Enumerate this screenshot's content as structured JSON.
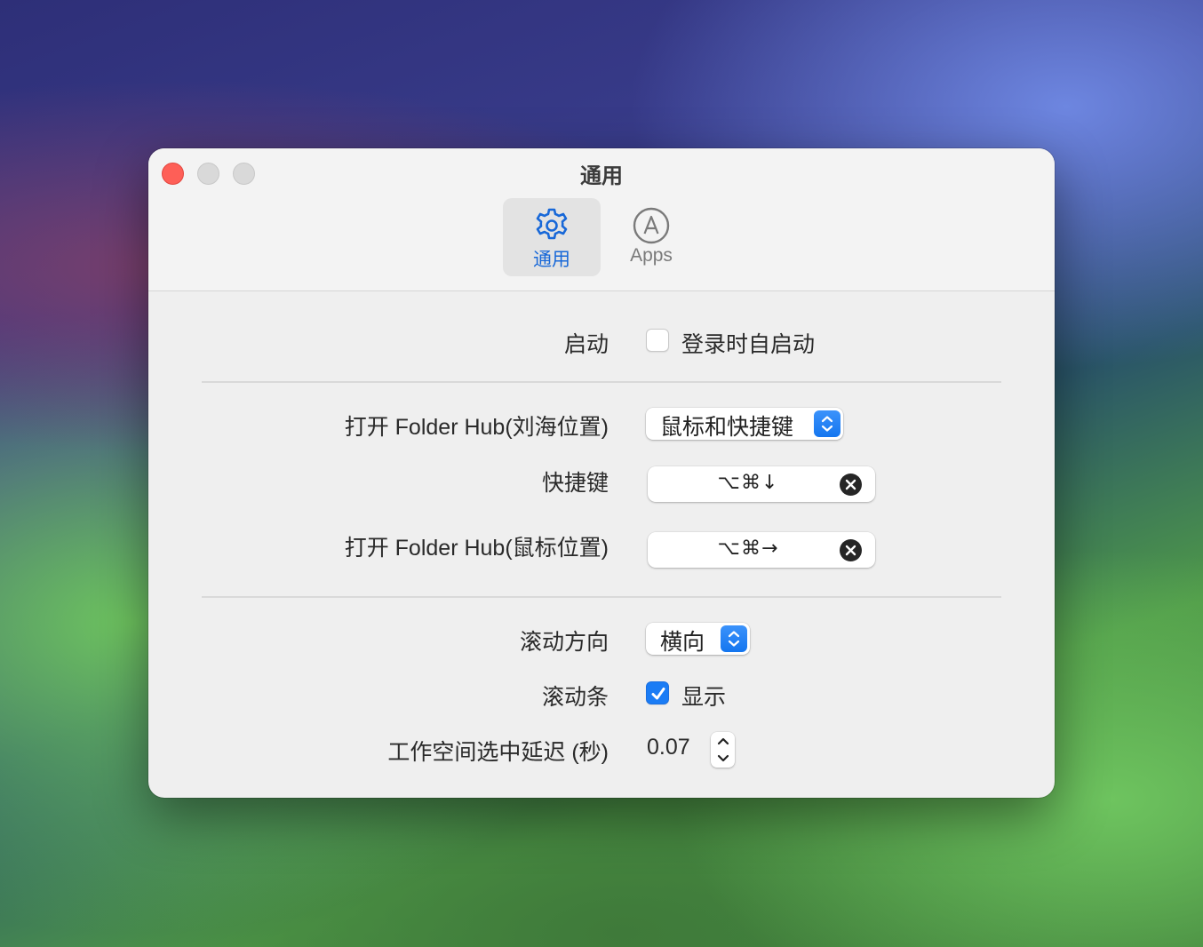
{
  "window": {
    "title": "通用",
    "traffic_lights": [
      "close",
      "minimize",
      "zoom"
    ]
  },
  "toolbar": {
    "tabs": [
      {
        "id": "general",
        "label": "通用",
        "icon": "gear-icon",
        "selected": true
      },
      {
        "id": "apps",
        "label": "Apps",
        "icon": "circle-a-icon",
        "selected": false
      }
    ]
  },
  "settings": {
    "launch": {
      "label": "启动",
      "checkbox_label": "登录时自启动",
      "checked": false
    },
    "open_notch": {
      "label": "打开 Folder Hub(刘海位置)",
      "selected_option": "鼠标和快捷键"
    },
    "shortcut": {
      "label": "快捷键",
      "keys": "⌥⌘↓"
    },
    "open_mouse": {
      "label": "打开 Folder Hub(鼠标位置)",
      "keys": "⌥⌘→"
    },
    "scroll_direction": {
      "label": "滚动方向",
      "selected_option": "横向"
    },
    "scrollbar": {
      "label": "滚动条",
      "checkbox_label": "显示",
      "checked": true
    },
    "workspace_delay": {
      "label": "工作空间选中延迟 (秒)",
      "value": "0.07"
    }
  },
  "colors": {
    "accent": "#1a7cf5",
    "close_button": "#fe5f57",
    "selected_tab_text": "#1868d8"
  }
}
